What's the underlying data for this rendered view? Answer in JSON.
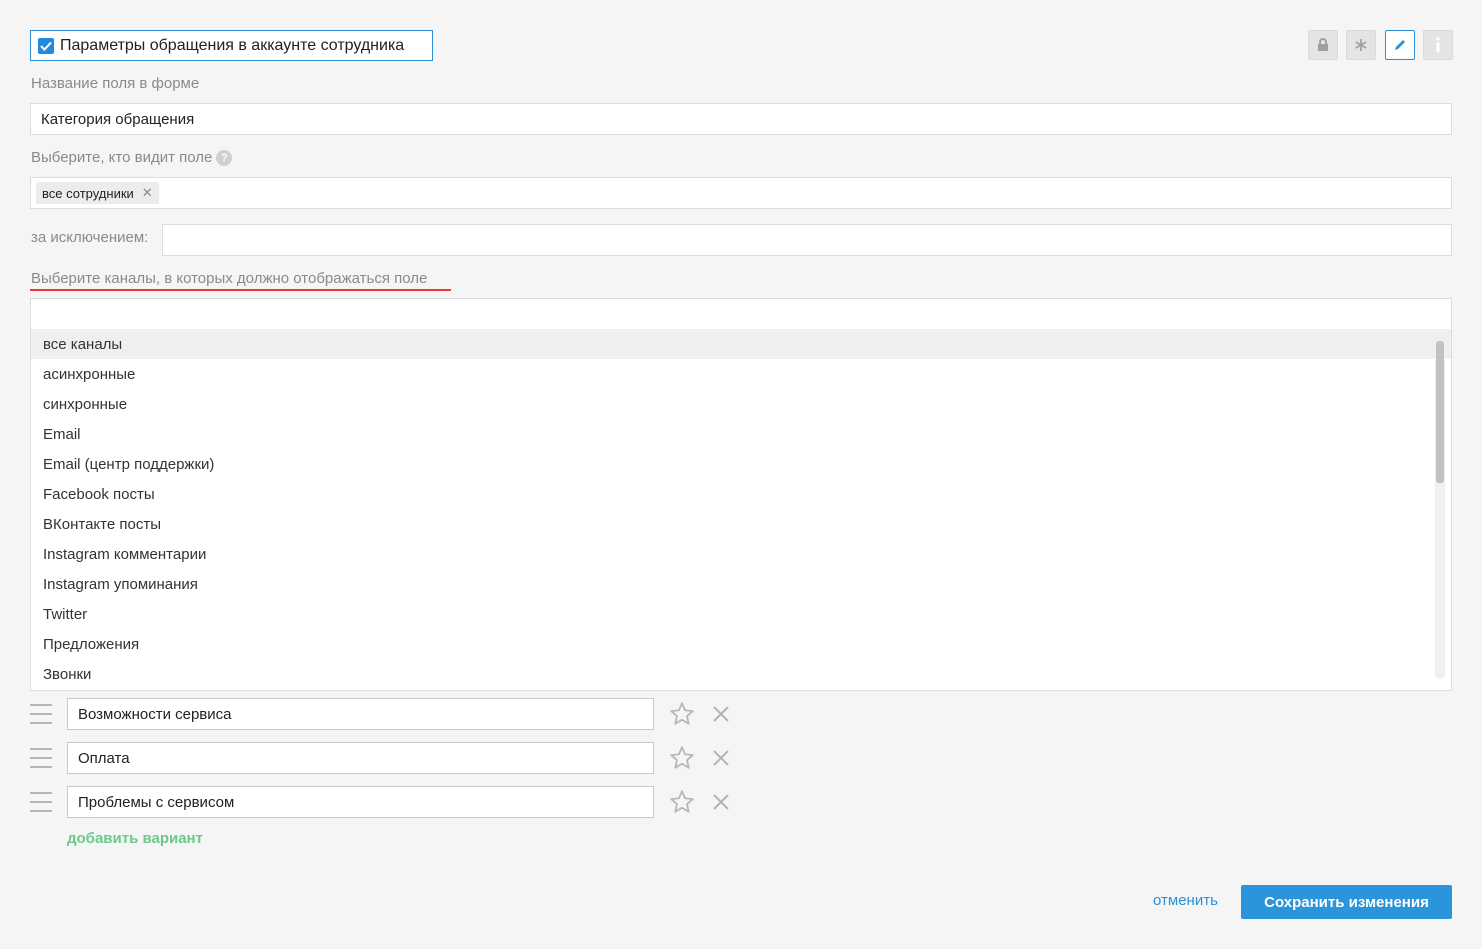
{
  "header": {
    "checkbox_label": "Параметры обращения в аккаунте сотрудника",
    "checkbox_checked": true,
    "tools": [
      "lock-icon",
      "asterisk-icon",
      "pencil-icon",
      "info-icon"
    ]
  },
  "field_name": {
    "label": "Название поля в форме",
    "value": "Категория обращения"
  },
  "visibility": {
    "label": "Выберите, кто видит поле",
    "chip": "все сотрудники",
    "except_label": "за исключением:",
    "except_value": ""
  },
  "channels": {
    "label": "Выберите каналы, в которых должно отображаться поле",
    "search_value": "",
    "items": [
      "все каналы",
      "асинхронные",
      "синхронные",
      "Email",
      "Email (центр поддержки)",
      "Facebook посты",
      "ВКонтакте посты",
      "Instagram комментарии",
      "Instagram упоминания",
      "Twitter",
      "Предложения",
      "Звонки"
    ]
  },
  "options": {
    "items": [
      "Возможности сервиса",
      "Оплата",
      "Проблемы с сервисом"
    ],
    "add_label": "добавить вариант"
  },
  "footer": {
    "cancel_label": "отменить",
    "save_label": "Сохранить изменения"
  },
  "colors": {
    "accent": "#2b95dc",
    "add_link": "#6cc98a",
    "underline": "#e53935"
  }
}
